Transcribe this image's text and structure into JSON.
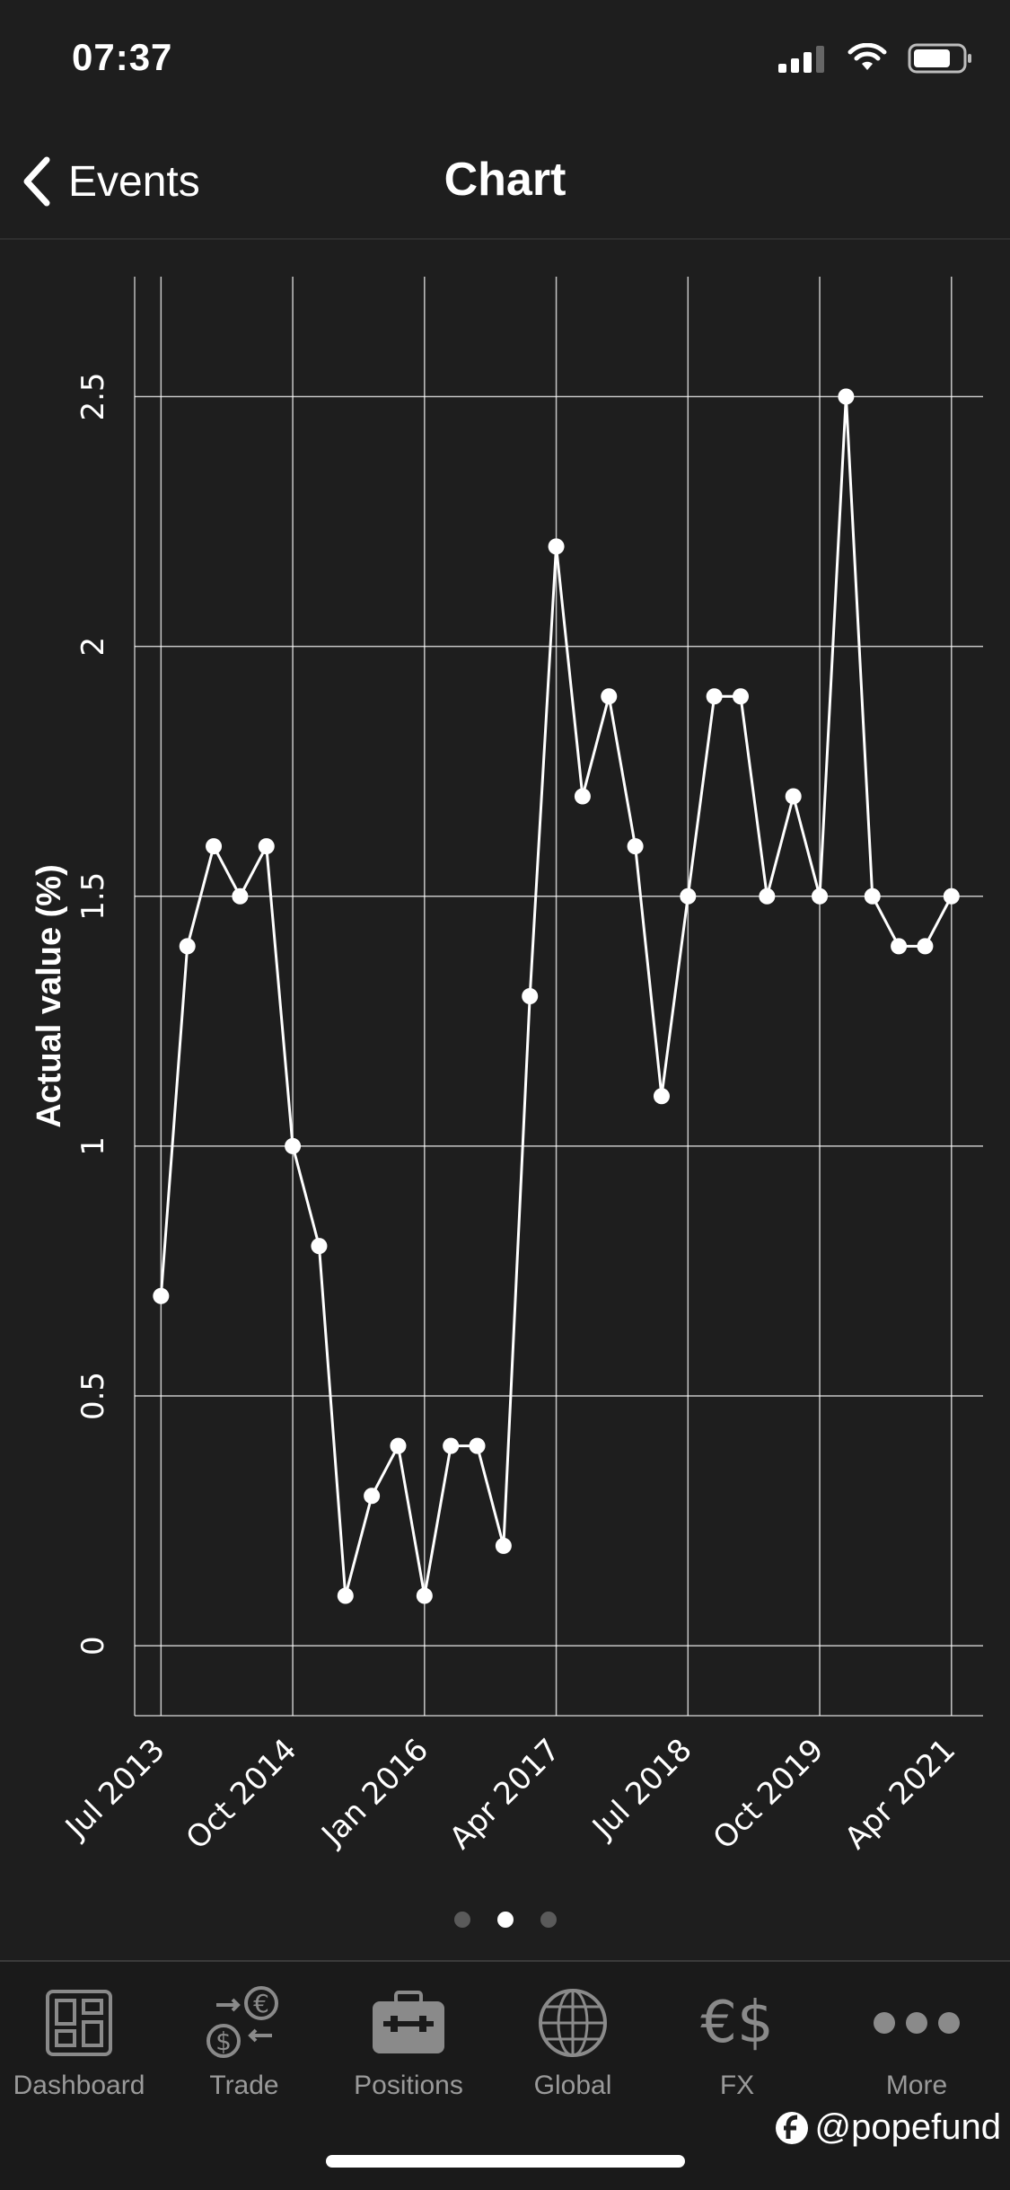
{
  "status": {
    "time": "07:37"
  },
  "nav": {
    "back_label": "Events",
    "title": "Chart"
  },
  "chart_data": {
    "type": "line",
    "ylabel": "Actual value (%)",
    "xlabel": "",
    "ylim": [
      -0.14,
      2.74
    ],
    "yticks": [
      0,
      0.5,
      1,
      1.5,
      2,
      2.5
    ],
    "yticklabels": [
      "0",
      "0.5",
      "1",
      "1.5",
      "2",
      "2.5"
    ],
    "xticklabels": [
      "Jul 2013",
      "Oct 2014",
      "Jan 2016",
      "Apr 2017",
      "Jul 2018",
      "Oct 2019",
      "Apr 2021"
    ],
    "xtick_quarter_index": [
      0,
      5,
      10,
      15,
      20,
      25,
      30
    ],
    "x_range_quarters": [
      -1,
      31.2
    ],
    "grid": true,
    "series": [
      {
        "x": [
          "Jul 2013",
          "Oct 2013",
          "Jan 2014",
          "Apr 2014",
          "Jul 2014",
          "Oct 2014",
          "Jan 2015",
          "Apr 2015",
          "Jul 2015",
          "Oct 2015",
          "Jan 2016",
          "Apr 2016",
          "Jul 2016",
          "Oct 2016",
          "Jan 2017",
          "Apr 2017",
          "Jul 2017",
          "Oct 2017",
          "Jan 2018",
          "Apr 2018",
          "Jul 2018",
          "Oct 2018",
          "Jan 2019",
          "Apr 2019",
          "Jul 2019",
          "Oct 2019",
          "Jan 2020",
          "Apr 2020",
          "Jul 2020",
          "Oct 2020",
          "Apr 2021"
        ],
        "x_quarter_index": [
          0,
          1,
          2,
          3,
          4,
          5,
          6,
          7,
          8,
          9,
          10,
          11,
          12,
          13,
          14,
          15,
          16,
          17,
          18,
          19,
          20,
          21,
          22,
          23,
          24,
          25,
          26,
          27,
          28,
          29,
          30
        ],
        "values": [
          0.7,
          1.4,
          1.6,
          1.5,
          1.6,
          1.0,
          0.8,
          0.1,
          0.3,
          0.4,
          0.1,
          0.4,
          0.4,
          0.2,
          1.3,
          2.2,
          1.7,
          1.9,
          1.6,
          1.1,
          1.5,
          1.9,
          1.9,
          1.5,
          1.7,
          1.5,
          2.5,
          1.5,
          1.4,
          1.4,
          1.5
        ]
      }
    ],
    "line_color": "#ffffff",
    "marker_color": "#ffffff",
    "grid_color": "#ffffff",
    "page_indicator": {
      "pages": 3,
      "active": 2
    }
  },
  "tabs": [
    {
      "label": "Dashboard",
      "icon": "dashboard-icon"
    },
    {
      "label": "Trade",
      "icon": "trade-icon"
    },
    {
      "label": "Positions",
      "icon": "positions-icon"
    },
    {
      "label": "Global",
      "icon": "globe-icon"
    },
    {
      "label": "FX",
      "icon": "fx-icon"
    },
    {
      "label": "More",
      "icon": "more-icon"
    }
  ],
  "watermark": {
    "text": "@popefund"
  },
  "colors": {
    "background": "#1e1e1e",
    "tab_bar": "#1a1a1a",
    "tab_label": "#9a9a9a"
  }
}
